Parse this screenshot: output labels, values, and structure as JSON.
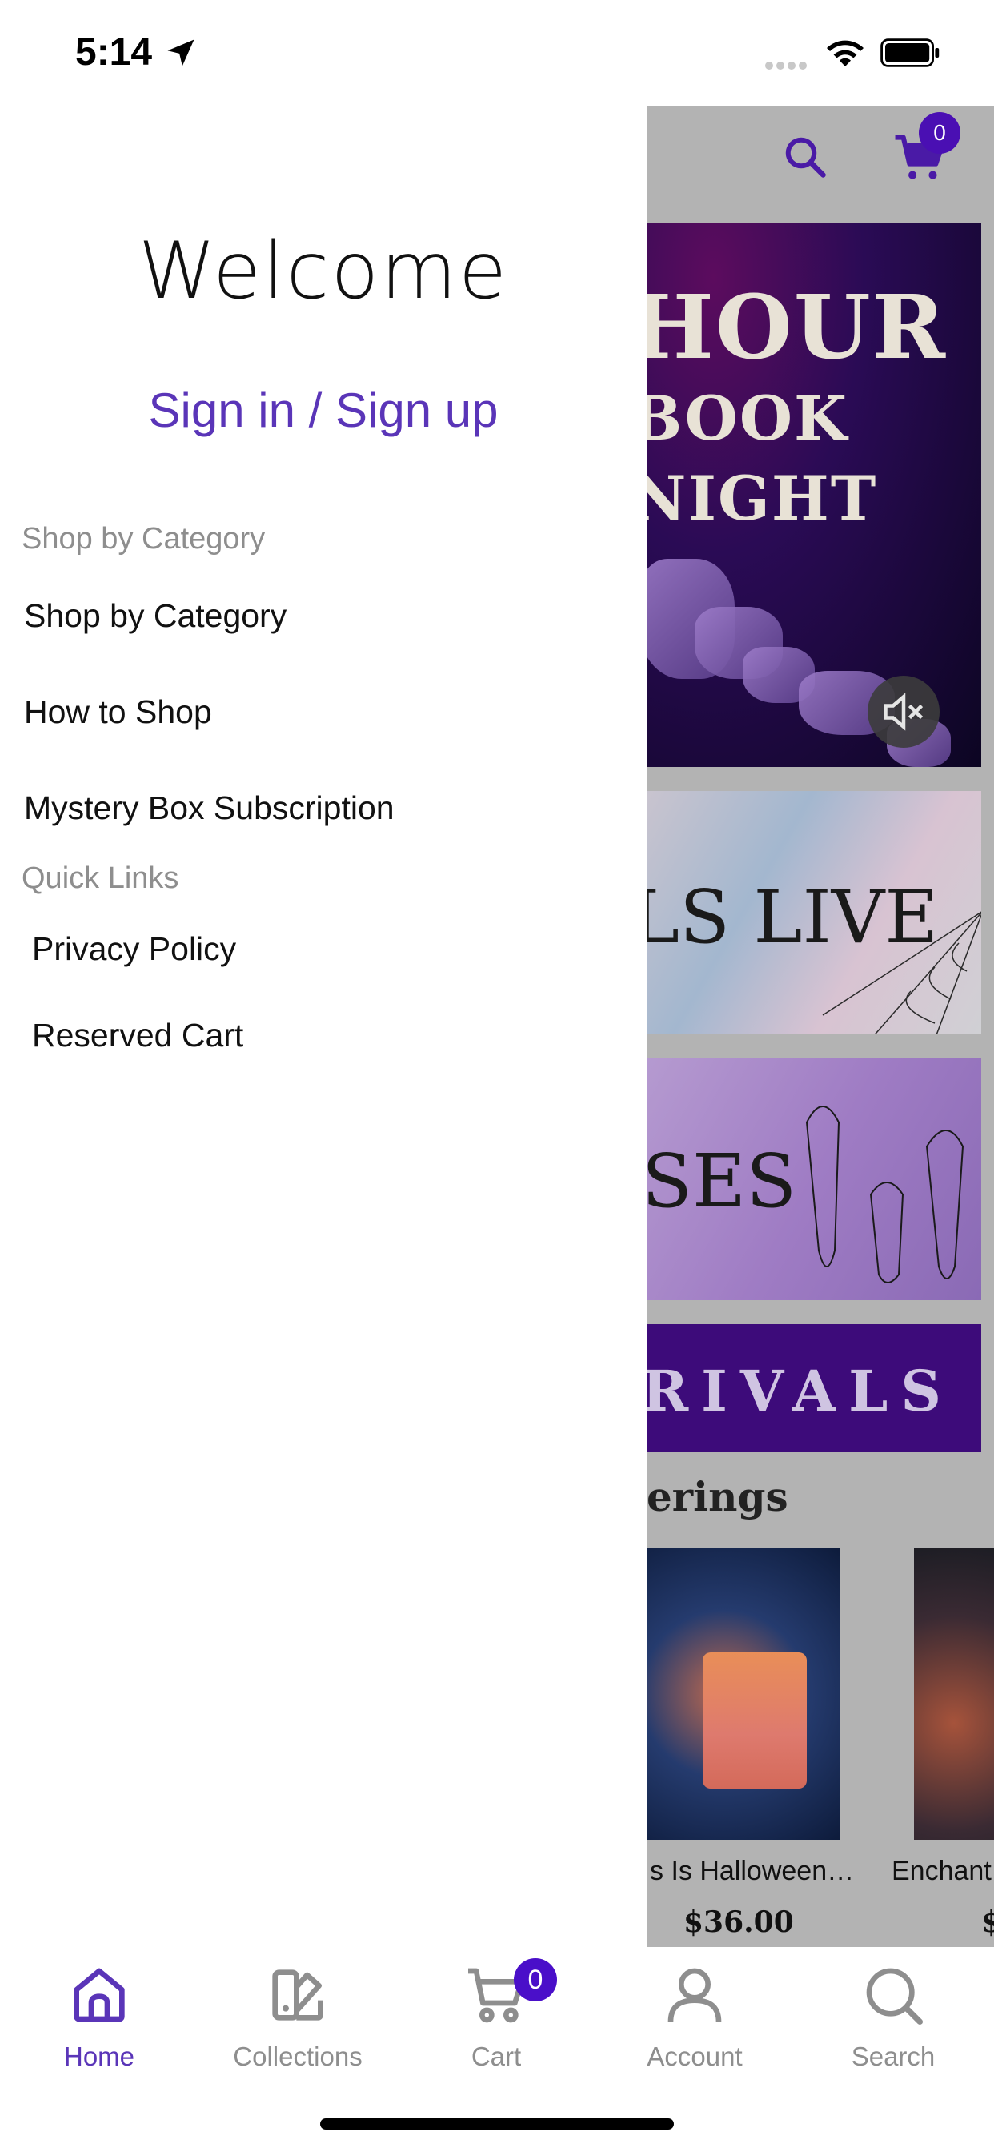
{
  "status_bar": {
    "time": "5:14"
  },
  "drawer": {
    "welcome": "Welcome",
    "signin_label": "Sign in / Sign up",
    "sections": [
      {
        "heading": "Shop by Category",
        "items": [
          "Shop by Category",
          "How to Shop",
          "Mystery Box Subscription"
        ]
      },
      {
        "heading": "Quick Links",
        "items": [
          "Privacy Policy",
          "Reserved Cart"
        ]
      }
    ]
  },
  "background_page": {
    "cart_count": "0",
    "banners": [
      "HOUR BOOK NIGHT",
      "LS LIVE",
      "SES",
      "RIVALS"
    ],
    "section_title": "erings",
    "products": [
      {
        "name": "s Is Halloween…",
        "price": "$36.00"
      },
      {
        "name": "Enchant",
        "price": "$"
      }
    ]
  },
  "tabbar": {
    "tabs": [
      {
        "label": "Home",
        "icon": "home-icon",
        "active": true
      },
      {
        "label": "Collections",
        "icon": "collections-icon",
        "active": false
      },
      {
        "label": "Cart",
        "icon": "cart-icon",
        "active": false
      },
      {
        "label": "Account",
        "icon": "account-icon",
        "active": false
      },
      {
        "label": "Search",
        "icon": "search-icon",
        "active": false
      }
    ],
    "cart_badge": "0"
  },
  "colors": {
    "accent": "#5a35b8",
    "badge": "#4a0fc9",
    "muted_text": "#8e8e8e",
    "scrim": "#b3b3b3"
  }
}
